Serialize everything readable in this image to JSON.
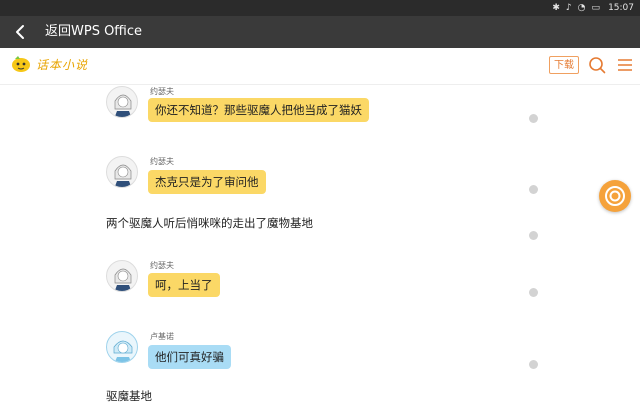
{
  "status_bar": {
    "time": "15:07",
    "icons": [
      "bluetooth-icon",
      "mute-icon",
      "wifi-icon",
      "battery-icon"
    ]
  },
  "title_bar": {
    "back_label": "返回WPS Office"
  },
  "header": {
    "logo_text": "话本小说",
    "download_label": "下载",
    "icons": [
      "search-icon",
      "menu-icon"
    ],
    "accent_color": "#e57b33"
  },
  "chat": [
    {
      "type": "message",
      "speaker": "约瑟夫",
      "text": "你还不知道？那些驱魔人把他当成了猫妖",
      "bubble_color": "#fbd866"
    },
    {
      "type": "message",
      "speaker": "约瑟夫",
      "text": "杰克只是为了审问他",
      "bubble_color": "#fbd866"
    },
    {
      "type": "narration",
      "text": "两个驱魔人听后悄咪咪的走出了魔物基地"
    },
    {
      "type": "message",
      "speaker": "约瑟夫",
      "text": "呵，上当了",
      "bubble_color": "#fbd866"
    },
    {
      "type": "message",
      "speaker": "卢基诺",
      "text": "他们可真好骗",
      "bubble_color": "#a9dcf5"
    },
    {
      "type": "narration",
      "text": "驱魔基地"
    }
  ]
}
